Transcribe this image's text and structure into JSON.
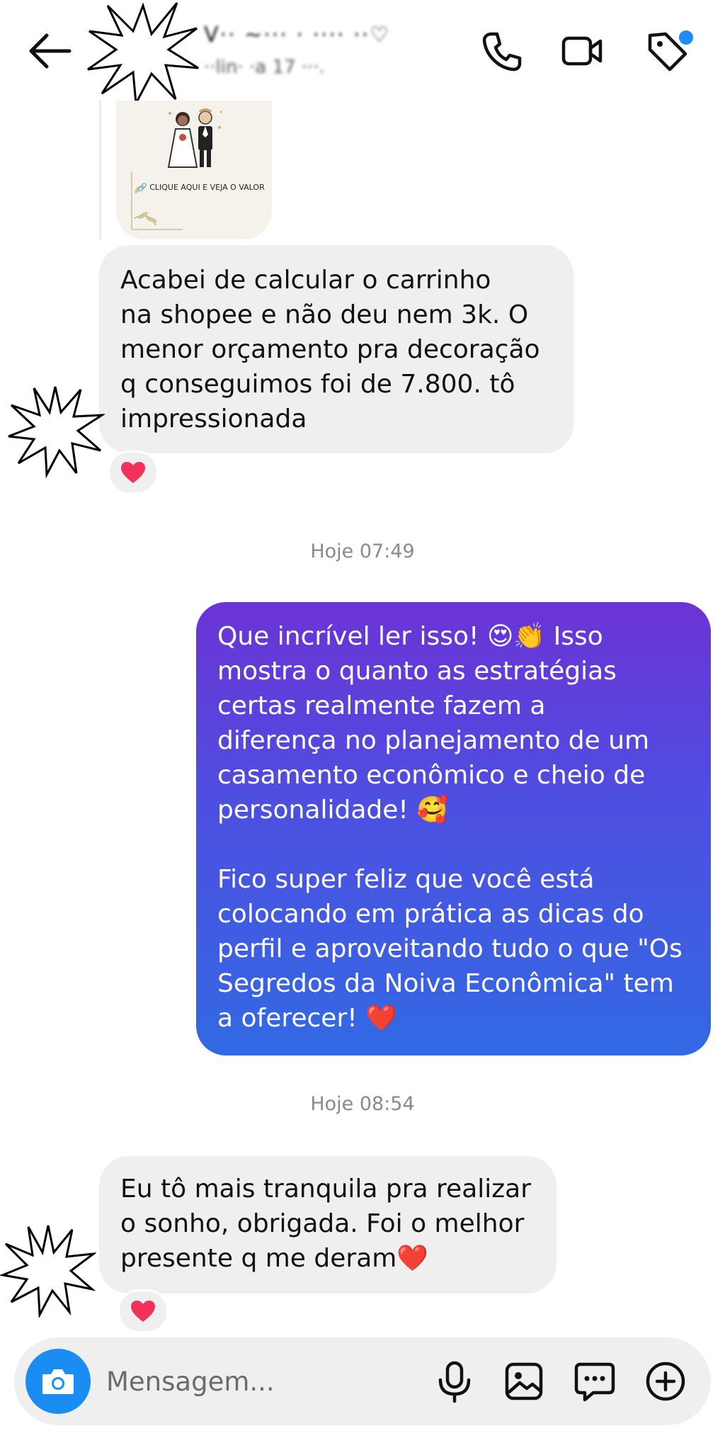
{
  "header": {
    "contact_name": "V·· ~··· · ···· ··♡",
    "status": "··lin· ·a 17 ···.",
    "tag_badge_color": "#1d8cf8"
  },
  "shared_post": {
    "link_text": "🔗 CLIQUE AQUI E VEJA O VALOR"
  },
  "messages": [
    {
      "direction": "in",
      "text": "Acabei de calcular o carrinho\nna shopee e não deu nem 3k. O\nmenor orçamento pra decoração\nq conseguimos foi de 7.800. tô\nimpressionada",
      "reaction": "❤️"
    },
    {
      "direction": "out",
      "timestamp": "Hoje 07:49",
      "text": "Que incrível ler isso! 😍👏 Isso\nmostra o quanto as estratégias\ncertas realmente fazem a\ndiferença no planejamento de um\ncasamento econômico e cheio de\npersonalidade! 🥰\n\nFico super feliz que você está\ncolocando em prática as dicas do\nperfil e aproveitando tudo o que \"Os\nSegredos da Noiva Econômica\" tem\na oferecer! ❤️"
    },
    {
      "direction": "in",
      "timestamp": "Hoje 08:54",
      "text": "Eu tô mais tranquila pra realizar\no sonho, obrigada. Foi o melhor\npresente q me deram❤️",
      "reaction": "❤️"
    }
  ],
  "composer": {
    "placeholder": "Mensagem...",
    "camera_color": "#1a8cf2",
    "icons": [
      "camera-icon",
      "microphone-icon",
      "gallery-icon",
      "sticker-icon",
      "plus-icon"
    ]
  },
  "colors": {
    "incoming_bubble": "#efefef",
    "outgoing_gradient_top": "#6b33d6",
    "outgoing_gradient_bottom": "#3269e4",
    "heart": "#f0325a"
  }
}
